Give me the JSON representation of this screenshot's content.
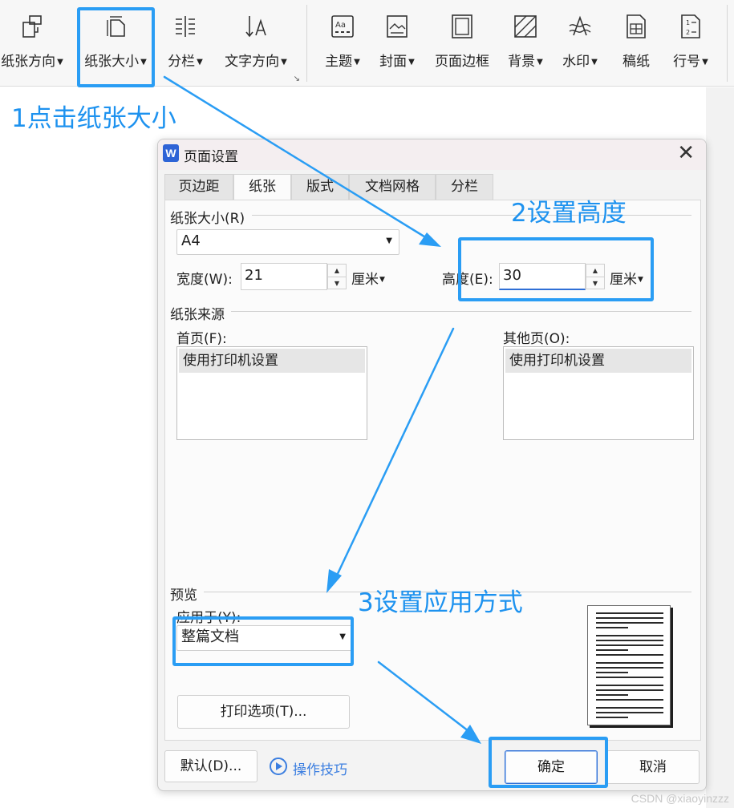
{
  "ribbon": {
    "items": [
      {
        "label": "纸张方向",
        "icon": "orientation-icon",
        "dropdown": true
      },
      {
        "label": "纸张大小",
        "icon": "paper-size-icon",
        "dropdown": true
      },
      {
        "label": "分栏",
        "icon": "columns-icon",
        "dropdown": true
      },
      {
        "label": "文字方向",
        "icon": "text-direction-icon",
        "dropdown": true
      },
      {
        "label": "主题",
        "icon": "theme-icon",
        "dropdown": true
      },
      {
        "label": "封面",
        "icon": "cover-icon",
        "dropdown": true
      },
      {
        "label": "页面边框",
        "icon": "page-border-icon",
        "dropdown": false
      },
      {
        "label": "背景",
        "icon": "background-icon",
        "dropdown": true
      },
      {
        "label": "水印",
        "icon": "watermark-icon",
        "dropdown": true
      },
      {
        "label": "稿纸",
        "icon": "manuscript-icon",
        "dropdown": false
      },
      {
        "label": "行号",
        "icon": "line-number-icon",
        "dropdown": true
      }
    ]
  },
  "dialog": {
    "app_icon": "W",
    "title": "页面设置",
    "tabs": [
      "页边距",
      "纸张",
      "版式",
      "文档网格",
      "分栏"
    ],
    "active_tab": "纸张",
    "paper_size": {
      "section": "纸张大小(R)",
      "value": "A4",
      "width_label": "宽度(W):",
      "width_value": "21",
      "width_unit": "厘米",
      "height_label": "高度(E):",
      "height_value": "30",
      "height_unit": "厘米"
    },
    "paper_source": {
      "section": "纸张来源",
      "first_page_label": "首页(F):",
      "first_page_item": "使用打印机设置",
      "other_pages_label": "其他页(O):",
      "other_pages_item": "使用打印机设置"
    },
    "preview": {
      "section": "预览",
      "apply_to_label": "应用于(Y):",
      "apply_to_value": "整篇文档",
      "print_options": "打印选项(T)..."
    },
    "footer": {
      "default_button": "默认(D)...",
      "tips_link": "操作技巧",
      "ok_button": "确定",
      "cancel_button": "取消"
    }
  },
  "annotations": {
    "step1": "1点击纸张大小",
    "step2": "2设置高度",
    "step3": "3设置应用方式",
    "color": "#2a9df4"
  },
  "watermark": "CSDN @xiaoyinzzz"
}
